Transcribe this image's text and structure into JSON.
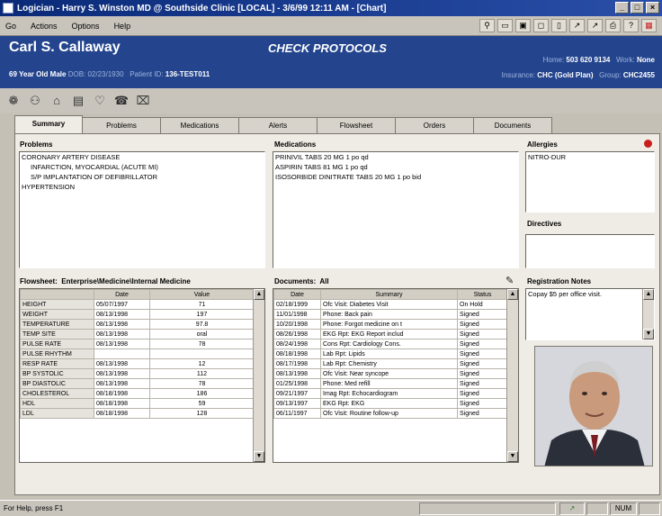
{
  "window": {
    "title": "Logician - Harry S. Winston MD @ Southside Clinic [LOCAL] - 3/6/99 12:11 AM - [Chart]"
  },
  "menu": {
    "items": [
      "Go",
      "Actions",
      "Options",
      "Help"
    ]
  },
  "patient": {
    "name": "Carl S. Callaway",
    "age_sex": "69 Year Old Male",
    "dob_label": "DOB:",
    "dob": "02/23/1930",
    "id_label": "Patient ID:",
    "id": "136-TEST011",
    "mode": "CHECK PROTOCOLS",
    "home_label": "Home:",
    "home": "503 620 9134",
    "work_label": "Work:",
    "work": "None",
    "insurance_label": "Insurance:",
    "insurance": "CHC (Gold Plan)",
    "group_label": "Group:",
    "group": "CHC2455"
  },
  "tabs": [
    "Summary",
    "Problems",
    "Medications",
    "Alerts",
    "Flowsheet",
    "Orders",
    "Documents"
  ],
  "problems": {
    "title": "Problems",
    "items": [
      "CORONARY ARTERY DISEASE",
      "INFARCTION, MYOCARDIAL (ACUTE MI)",
      "S/P IMPLANTATION OF DEFIBRILLATOR",
      "HYPERTENSION"
    ]
  },
  "medications": {
    "title": "Medications",
    "items": [
      "PRINIVIL TABS 20 MG 1 po qd",
      "ASPIRIN TABS 81 MG 1 po qd",
      "ISOSORBIDE DINITRATE TABS 20 MG 1 po bid"
    ]
  },
  "allergies": {
    "title": "Allergies",
    "items": [
      "NITRO-DUR"
    ]
  },
  "directives": {
    "title": "Directives"
  },
  "flowsheet": {
    "title": "Flowsheet:",
    "view": "Enterprise\\Medicine\\Internal Medicine",
    "headers": [
      "",
      "Date",
      "Value"
    ],
    "rows": [
      [
        "HEIGHT",
        "05/07/1997",
        "71"
      ],
      [
        "WEIGHT",
        "08/13/1998",
        "197"
      ],
      [
        "TEMPERATURE",
        "08/13/1998",
        "97.8"
      ],
      [
        "TEMP SITE",
        "08/13/1998",
        "oral"
      ],
      [
        "PULSE RATE",
        "08/13/1998",
        "78"
      ],
      [
        "PULSE RHYTHM",
        "",
        ""
      ],
      [
        "RESP RATE",
        "08/13/1998",
        "12"
      ],
      [
        "BP SYSTOLIC",
        "08/13/1998",
        "112"
      ],
      [
        "BP DIASTOLIC",
        "08/13/1998",
        "78"
      ],
      [
        "CHOLESTEROL",
        "08/18/1998",
        "186"
      ],
      [
        "HDL",
        "08/18/1998",
        "59"
      ],
      [
        "LDL",
        "08/18/1998",
        "128"
      ]
    ]
  },
  "documents": {
    "title": "Documents:",
    "filter": "All",
    "headers": [
      "Date",
      "Summary",
      "Status"
    ],
    "rows": [
      [
        "02/18/1999",
        "Ofc Visit: Diabetes Visit",
        "On Hold"
      ],
      [
        "11/01/1998",
        "Phone: Back pain",
        "Signed"
      ],
      [
        "10/20/1998",
        "Phone: Forgot medicine on t",
        "Signed"
      ],
      [
        "08/26/1998",
        "EKG Rpt: EKG Report includ",
        "Signed"
      ],
      [
        "08/24/1998",
        "Cons Rpt: Cardiology Cons.",
        "Signed"
      ],
      [
        "08/18/1998",
        "Lab Rpt: Lipids",
        "Signed"
      ],
      [
        "08/17/1998",
        "Lab Rpt: Chemistry",
        "Signed"
      ],
      [
        "08/13/1998",
        "Ofc Visit: Near syncope",
        "Signed"
      ],
      [
        "01/25/1998",
        "Phone: Med refill",
        "Signed"
      ],
      [
        "09/21/1997",
        "Imag Rpt: Echocardiogram",
        "Signed"
      ],
      [
        "09/13/1997",
        "EKG Rpt: EKG",
        "Signed"
      ],
      [
        "06/11/1997",
        "Ofc Visit: Routine follow-up",
        "Signed"
      ]
    ]
  },
  "registration": {
    "title": "Registration Notes",
    "text": "Copay $5 per office visit."
  },
  "status": {
    "help": "For Help, press F1",
    "num": "NUM"
  }
}
